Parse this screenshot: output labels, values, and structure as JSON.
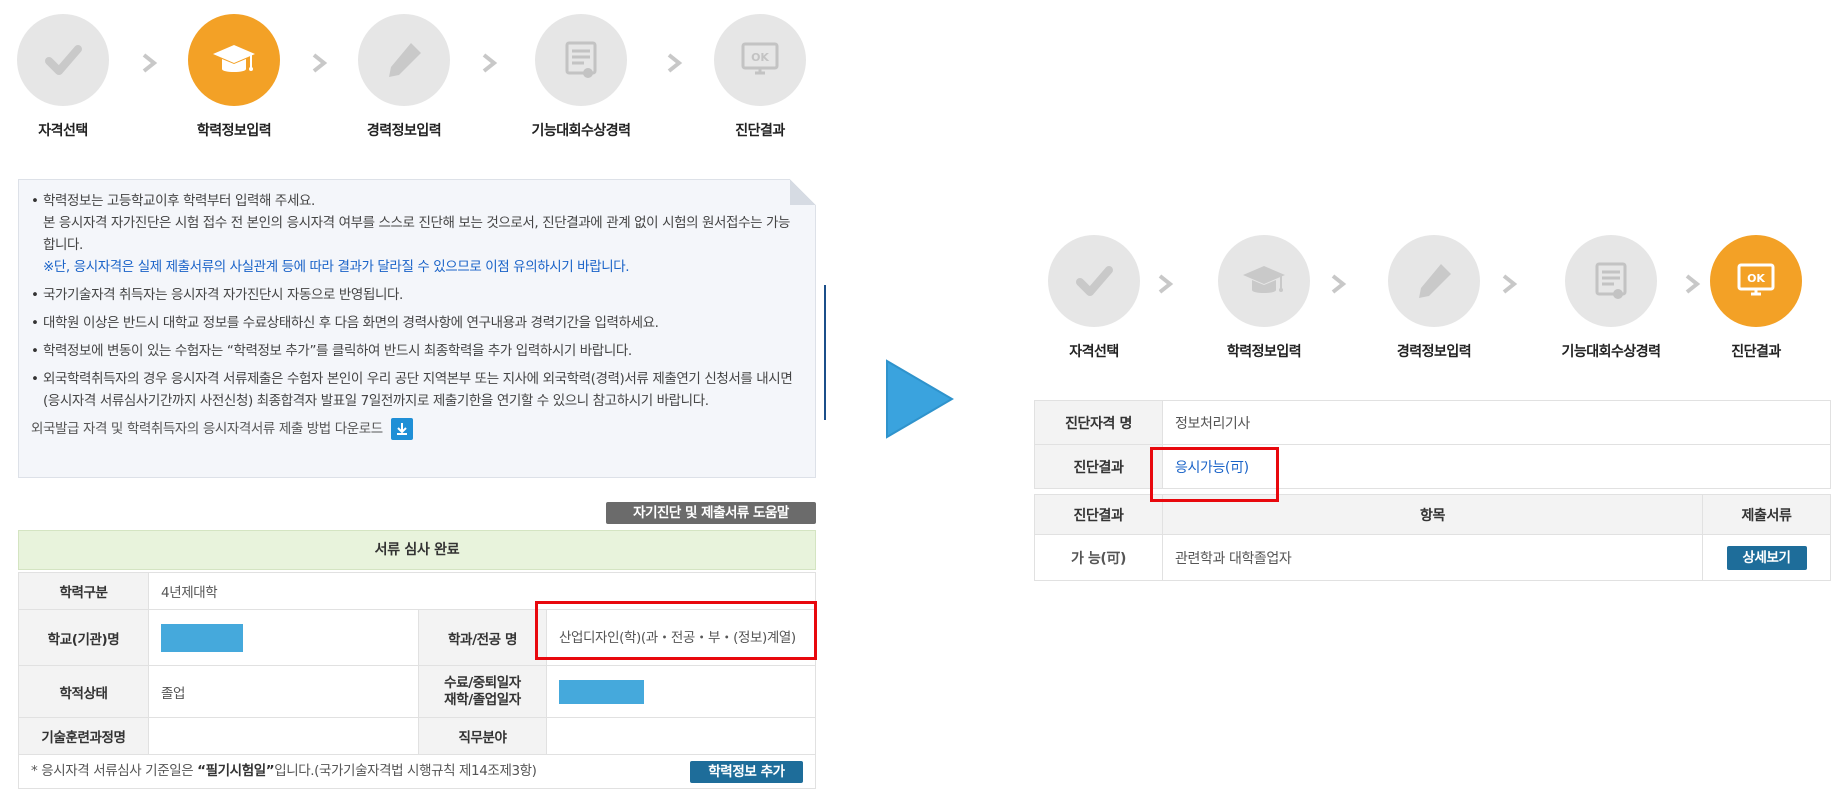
{
  "left_steps": [
    {
      "label": "자격선택",
      "icon": "check-icon",
      "active": false
    },
    {
      "label": "학력정보입력",
      "icon": "graduation-cap-icon",
      "active": true
    },
    {
      "label": "경력정보입력",
      "icon": "pencil-icon",
      "active": false
    },
    {
      "label": "기능대회수상경력",
      "icon": "certificate-icon",
      "active": false
    },
    {
      "label": "진단결과",
      "icon": "ok-monitor-icon",
      "active": false
    }
  ],
  "right_steps": [
    {
      "label": "자격선택",
      "icon": "check-icon",
      "active": false
    },
    {
      "label": "학력정보입력",
      "icon": "graduation-cap-icon",
      "active": false
    },
    {
      "label": "경력정보입력",
      "icon": "pencil-icon",
      "active": false
    },
    {
      "label": "기능대회수상경력",
      "icon": "certificate-icon",
      "active": false
    },
    {
      "label": "진단결과",
      "icon": "ok-monitor-icon",
      "active": true
    }
  ],
  "notice": {
    "item1_line1": "학력정보는 고등학교이후 학력부터 입력해 주세요.",
    "item1_line2": "본 응시자격 자가진단은 시험 접수 전 본인의 응시자격 여부를 스스로 진단해 보는 것으로서, 진단결과에 관계 없이 시험의 원서접수는 가능합니다.",
    "item1_note": "※단, 응시자격은 실제 제출서류의 사실관계 등에 따라 결과가 달라질 수 있으므로 이점 유의하시기 바랍니다.",
    "item2": "국가기술자격 취득자는 응시자격 자가진단시 자동으로 반영됩니다.",
    "item3": "대학원 이상은 반드시 대학교 정보를 수료상태하신 후 다음 화면의 경력사항에 연구내용과 경력기간을 입력하세요.",
    "item4": "학력정보에 변동이 있는 수험자는 “학력정보 추가”를 클릭하여 반드시 최종학력을 추가 입력하시기 바랍니다.",
    "item5": "외국학력취득자의 경우 응시자격 서류제출은 수험자 본인이 우리 공단 지역본부 또는 지사에 외국학력(경력)서류 제출연기 신청서를 내시면(응시자격 서류심사기간까지 사전신청) 최종합격자 발표일 7일전까지로 제출기한을 연기할 수 있으니 참고하시기 바랍니다.",
    "download_text": "외국발급 자격 및 학력취득자의 응시자격서류 제출 방법 다운로드"
  },
  "help_button": "자기진단 및 제출서류 도움말",
  "education": {
    "status_header": "서류 심사 완료",
    "type_label": "학력구분",
    "type_value": "4년제대학",
    "school_label": "학교(기관)명",
    "major_label": "학과/전공 명",
    "major_value": "산업디자인(학)(과・전공・부・(정보)계열)",
    "enroll_label": "학적상태",
    "enroll_value": "졸업",
    "date_label_line1": "수료/중퇴일자",
    "date_label_line2": "재학/졸업일자",
    "training_label": "기술훈련과정명",
    "job_label": "직무분야",
    "footer_prefix": "* 응시자격 서류심사 기준일은 ",
    "footer_bold": "“필기시험일”",
    "footer_suffix": "입니다.(국가기술자격법 시행규칙 제14조제3항)",
    "add_button": "학력정보 추가"
  },
  "result": {
    "qual_label": "진단자격 명",
    "qual_value": "정보처리기사",
    "result_label": "진단결과",
    "result_value": "응시가능(可)"
  },
  "detail": {
    "col_result": "진단결과",
    "col_item": "항목",
    "col_docs": "제출서류",
    "row_result": "가 능(可)",
    "row_item": "관련학과 대학졸업자",
    "row_button": "상세보기"
  },
  "colors": {
    "active_step": "#f3a126",
    "inactive_step": "#e6e6e6",
    "highlight": "#e8080d",
    "arrow": "#3aa3de",
    "button": "#1e6d9a",
    "link_blue": "#1a63c8"
  }
}
